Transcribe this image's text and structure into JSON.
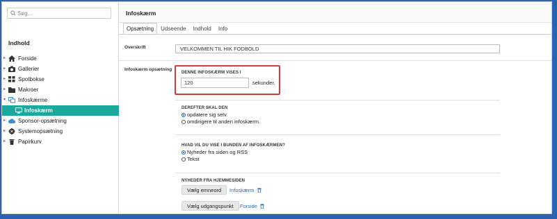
{
  "sidebar": {
    "search_placeholder": "Søg...",
    "title": "Indhold",
    "items": [
      {
        "label": "Forside",
        "icon": "home-icon",
        "arrow": "▸"
      },
      {
        "label": "Gallerier",
        "icon": "camera-icon",
        "arrow": "▸"
      },
      {
        "label": "Spotbokse",
        "icon": "grid-icon",
        "arrow": "▸"
      },
      {
        "label": "Makroer",
        "icon": "folder-icon",
        "arrow": "▸"
      },
      {
        "label": "Infoskærme",
        "icon": "screens-icon",
        "arrow": "▾"
      },
      {
        "label": "Infoskærm",
        "icon": "monitor-icon",
        "arrow": ""
      },
      {
        "label": "Sponsor-opsætning",
        "icon": "cloud-icon",
        "arrow": "▸"
      },
      {
        "label": "Systemopsætning",
        "icon": "gear-icon",
        "arrow": "▸"
      },
      {
        "label": "Papirkurv",
        "icon": "trash-icon",
        "arrow": "▸"
      }
    ]
  },
  "header": {
    "title": "Infoskærm"
  },
  "tabs": [
    "Opsætning",
    "Udseende",
    "Indhold",
    "Info"
  ],
  "form": {
    "heading_label": "Overskrift",
    "heading_value": "VELKOMMEN TIL HIK FODBOLD",
    "setup_label": "Infoskærm opsætning",
    "duration_heading": "DENNE INFOSKÆRM VISES I",
    "duration_value": "120",
    "duration_unit": "sekunder.",
    "after_heading": "DEREFTER SKAL DEN",
    "after_options": [
      "opdatere sig selv.",
      "omdirigere til anden infoskærm."
    ],
    "bottom_heading": "HVAD VIL DU VISE I BUNDEN AF INFOSKÆRMEN?",
    "bottom_options": [
      "Nyheder fra siden og RSS",
      "Tekst"
    ],
    "news_heading": "NYHEDER FRA HJEMMESIDEN",
    "choose_topic_button": "Vælg emneord",
    "topic_link": "Infoskærm",
    "choose_start_button": "Vælg udgangspunkt",
    "start_link": "Forside"
  },
  "colors": {
    "accent": "#1aaa9b",
    "link": "#2b6bb7",
    "highlight": "#d63a3a",
    "frame": "#2a64b0"
  }
}
